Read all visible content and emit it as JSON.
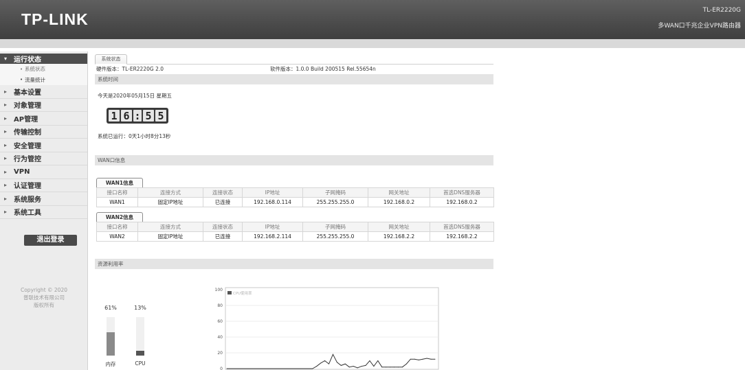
{
  "header": {
    "logo": "TP-LINK",
    "model": "TL-ER2220G",
    "product": "多WAN口千兆企业VPN路由器"
  },
  "colors": {
    "header": "#4b4b4b",
    "menu_active": "#4e4e4e",
    "logout_button": "#4a4a4a",
    "section_bar": "#e4e4e4"
  },
  "sidebar": {
    "items": [
      {
        "label": "运行状态",
        "icon": "chevron-down-icon",
        "expanded": true,
        "children": [
          "系统状态",
          "流量统计"
        ]
      },
      {
        "label": "基本设置",
        "icon": "chevron-right-icon"
      },
      {
        "label": "对象管理",
        "icon": "chevron-right-icon"
      },
      {
        "label": "AP管理",
        "icon": "chevron-right-icon"
      },
      {
        "label": "传输控制",
        "icon": "chevron-right-icon"
      },
      {
        "label": "安全管理",
        "icon": "chevron-right-icon"
      },
      {
        "label": "行为管控",
        "icon": "chevron-right-icon"
      },
      {
        "label": "VPN",
        "icon": "chevron-right-icon"
      },
      {
        "label": "认证管理",
        "icon": "chevron-right-icon"
      },
      {
        "label": "系统服务",
        "icon": "chevron-right-icon"
      },
      {
        "label": "系统工具",
        "icon": "chevron-right-icon"
      }
    ],
    "logout": "退出登录",
    "copyright": [
      "Copyright © 2020",
      "普联技术有限公司",
      "版权所有"
    ]
  },
  "main": {
    "tab": "系统状态",
    "hardware_version": "硬件版本：TL-ER2220G 2.0",
    "software_version": "软件版本：1.0.0 Build 200515 Rel.55654n"
  },
  "system_time": {
    "title": "系统时间",
    "date": "今天是2020年05月15日 星期五",
    "clock_digits": [
      "1",
      "6",
      ":",
      "5",
      "5"
    ],
    "uptime": "系统已运行：0天1小时8分13秒"
  },
  "wan": {
    "title": "WAN口信息",
    "columns": [
      "接口名称",
      "连接方式",
      "连接状态",
      "IP地址",
      "子网掩码",
      "网关地址",
      "首选DNS服务器"
    ],
    "interfaces": [
      {
        "tab": "WAN1信息",
        "row": [
          "WAN1",
          "固定IP地址",
          "已连接",
          "192.168.0.114",
          "255.255.255.0",
          "192.168.0.2",
          "192.168.0.2"
        ]
      },
      {
        "tab": "WAN2信息",
        "row": [
          "WAN2",
          "固定IP地址",
          "已连接",
          "192.168.2.114",
          "255.255.255.0",
          "192.168.2.2",
          "192.168.2.2"
        ]
      }
    ]
  },
  "resources": {
    "title": "资源利用率"
  },
  "chart_data": [
    {
      "type": "bar",
      "categories": [
        "内存",
        "CPU"
      ],
      "values": [
        61,
        13
      ],
      "data_labels": [
        "61%",
        "13%"
      ],
      "ylim": [
        0,
        100
      ]
    },
    {
      "type": "line",
      "series": [
        {
          "name": "CPU使用率",
          "values": [
            0,
            0,
            0,
            0,
            0,
            0,
            0,
            0,
            0,
            0,
            0,
            0,
            0,
            0,
            0,
            0,
            0,
            0,
            0,
            0,
            0,
            0,
            3,
            7,
            10,
            6,
            18,
            8,
            4,
            6,
            2,
            3,
            1,
            3,
            4,
            10,
            3,
            10,
            2,
            2,
            2,
            2,
            2,
            2,
            6,
            12,
            12,
            11,
            12,
            13,
            12,
            12
          ]
        }
      ],
      "yticks": [
        0,
        20,
        40,
        60,
        80,
        100
      ],
      "ylim": [
        0,
        100
      ],
      "grid": true,
      "legend": "top-left"
    }
  ]
}
